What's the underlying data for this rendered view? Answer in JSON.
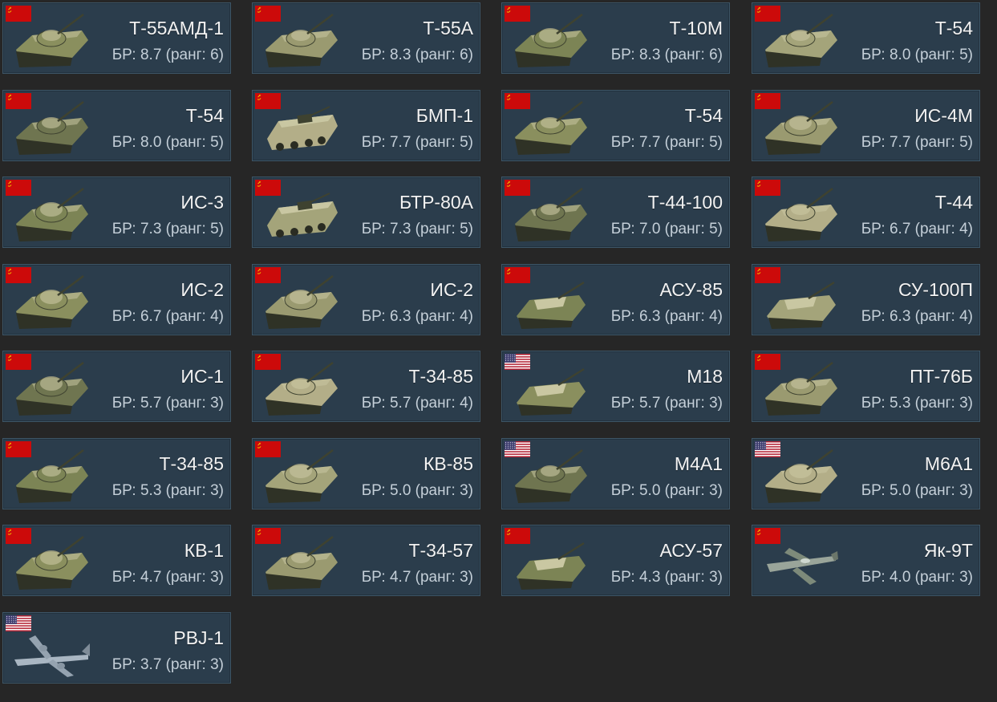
{
  "colors": {
    "background": "#262626",
    "card_background": "#2b3d4c",
    "card_border": "#3d5566",
    "title_text": "#f2f2f2",
    "br_text": "#c4cfd8",
    "ussr_red": "#cc0a0a",
    "usa_blue": "#3c3b6e",
    "usa_red": "#b22234"
  },
  "vehicles": [
    {
      "name": "Т-55АМД-1",
      "br": "БР: 8.7 (ранг: 6)",
      "flag": "ussr-flag-icon",
      "kind": "tank"
    },
    {
      "name": "Т-55А",
      "br": "БР: 8.3 (ранг: 6)",
      "flag": "ussr-flag-icon",
      "kind": "tank"
    },
    {
      "name": "Т-10М",
      "br": "БР: 8.3 (ранг: 6)",
      "flag": "ussr-flag-icon",
      "kind": "heavy-tank"
    },
    {
      "name": "Т-54",
      "br": "БР: 8.0 (ранг: 5)",
      "flag": "ussr-flag-icon",
      "kind": "tank"
    },
    {
      "name": "Т-54",
      "br": "БР: 8.0 (ранг: 5)",
      "flag": "ussr-flag-icon",
      "kind": "tank"
    },
    {
      "name": "БМП-1",
      "br": "БР: 7.7 (ранг: 5)",
      "flag": "ussr-flag-icon",
      "kind": "ifv"
    },
    {
      "name": "Т-54",
      "br": "БР: 7.7 (ранг: 5)",
      "flag": "ussr-flag-icon",
      "kind": "tank"
    },
    {
      "name": "ИС-4М",
      "br": "БР: 7.7 (ранг: 5)",
      "flag": "ussr-flag-icon",
      "kind": "heavy-tank"
    },
    {
      "name": "ИС-3",
      "br": "БР: 7.3 (ранг: 5)",
      "flag": "ussr-flag-icon",
      "kind": "heavy-tank"
    },
    {
      "name": "БТР-80А",
      "br": "БР: 7.3 (ранг: 5)",
      "flag": "ussr-flag-icon",
      "kind": "apc"
    },
    {
      "name": "Т-44-100",
      "br": "БР: 7.0 (ранг: 5)",
      "flag": "ussr-flag-icon",
      "kind": "tank"
    },
    {
      "name": "Т-44",
      "br": "БР: 6.7 (ранг: 4)",
      "flag": "ussr-flag-icon",
      "kind": "tank"
    },
    {
      "name": "ИС-2",
      "br": "БР: 6.7 (ранг: 4)",
      "flag": "ussr-flag-icon",
      "kind": "heavy-tank"
    },
    {
      "name": "ИС-2",
      "br": "БР: 6.3 (ранг: 4)",
      "flag": "ussr-flag-icon",
      "kind": "heavy-tank"
    },
    {
      "name": "АСУ-85",
      "br": "БР: 6.3 (ранг: 4)",
      "flag": "ussr-flag-icon",
      "kind": "spg"
    },
    {
      "name": "СУ-100П",
      "br": "БР: 6.3 (ранг: 4)",
      "flag": "ussr-flag-icon",
      "kind": "spg"
    },
    {
      "name": "ИС-1",
      "br": "БР: 5.7 (ранг: 3)",
      "flag": "ussr-flag-icon",
      "kind": "heavy-tank"
    },
    {
      "name": "Т-34-85",
      "br": "БР: 5.7 (ранг: 4)",
      "flag": "ussr-flag-icon",
      "kind": "tank"
    },
    {
      "name": "M18",
      "br": "БР: 5.7 (ранг: 3)",
      "flag": "usa-flag-icon",
      "kind": "tank-destroyer"
    },
    {
      "name": "ПТ-76Б",
      "br": "БР: 5.3 (ранг: 3)",
      "flag": "ussr-flag-icon",
      "kind": "tank"
    },
    {
      "name": "Т-34-85",
      "br": "БР: 5.3 (ранг: 3)",
      "flag": "ussr-flag-icon",
      "kind": "tank"
    },
    {
      "name": "КВ-85",
      "br": "БР: 5.0 (ранг: 3)",
      "flag": "ussr-flag-icon",
      "kind": "heavy-tank"
    },
    {
      "name": "M4A1",
      "br": "БР: 5.0 (ранг: 3)",
      "flag": "usa-flag-icon",
      "kind": "tank"
    },
    {
      "name": "M6A1",
      "br": "БР: 5.0 (ранг: 3)",
      "flag": "usa-flag-icon",
      "kind": "heavy-tank"
    },
    {
      "name": "КВ-1",
      "br": "БР: 4.7 (ранг: 3)",
      "flag": "ussr-flag-icon",
      "kind": "heavy-tank"
    },
    {
      "name": "Т-34-57",
      "br": "БР: 4.7 (ранг: 3)",
      "flag": "ussr-flag-icon",
      "kind": "tank"
    },
    {
      "name": "АСУ-57",
      "br": "БР: 4.3 (ранг: 3)",
      "flag": "ussr-flag-icon",
      "kind": "spg"
    },
    {
      "name": "Як-9Т",
      "br": "БР: 4.0 (ранг: 3)",
      "flag": "ussr-flag-icon",
      "kind": "fighter-plane"
    },
    {
      "name": "PBJ-1",
      "br": "БР: 3.7 (ранг: 3)",
      "flag": "usa-flag-icon",
      "kind": "bomber-plane"
    }
  ]
}
